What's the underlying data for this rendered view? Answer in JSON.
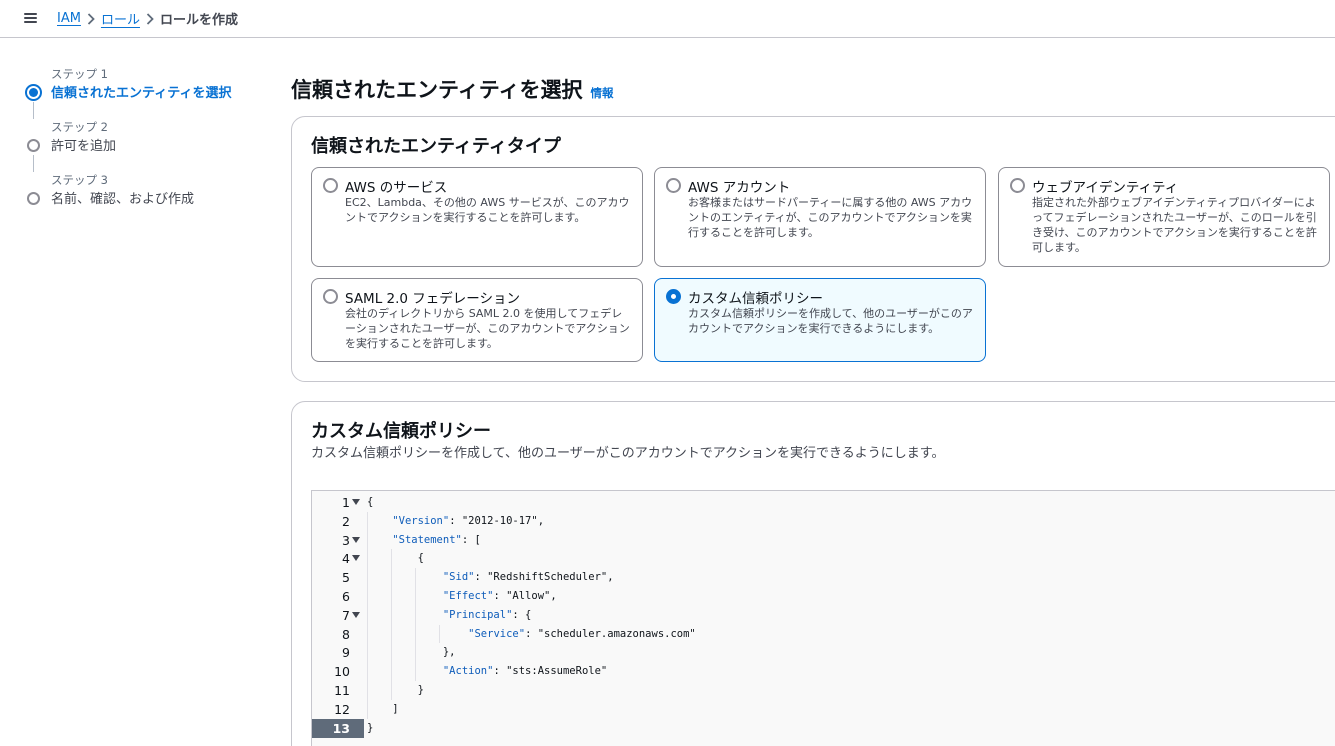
{
  "breadcrumb": {
    "items": [
      "IAM",
      "ロール"
    ],
    "current": "ロールを作成"
  },
  "steps": [
    {
      "num": "ステップ 1",
      "label": "信頼されたエンティティを選択",
      "active": true
    },
    {
      "num": "ステップ 2",
      "label": "許可を追加",
      "active": false
    },
    {
      "num": "ステップ 3",
      "label": "名前、確認、および作成",
      "active": false
    }
  ],
  "page": {
    "title": "信頼されたエンティティを選択",
    "info": "情報"
  },
  "entity_type": {
    "title": "信頼されたエンティティタイプ",
    "options": [
      {
        "title": "AWS のサービス",
        "desc": "EC2、Lambda、その他の AWS サービスが、このアカウントでアクションを実行することを許可します。",
        "selected": false
      },
      {
        "title": "AWS アカウント",
        "desc": "お客様またはサードパーティーに属する他の AWS アカウントのエンティティが、このアカウントでアクションを実行することを許可します。",
        "selected": false
      },
      {
        "title": "ウェブアイデンティティ",
        "desc": "指定された外部ウェブアイデンティティプロバイダーによってフェデレーションされたユーザーが、このロールを引き受け、このアカウントでアクションを実行することを許可します。",
        "selected": false
      },
      {
        "title": "SAML 2.0 フェデレーション",
        "desc": "会社のディレクトリから SAML 2.0 を使用してフェデレーションされたユーザーが、このアカウントでアクションを実行することを許可します。",
        "selected": false
      },
      {
        "title": "カスタム信頼ポリシー",
        "desc": "カスタム信頼ポリシーを作成して、他のユーザーがこのアカウントでアクションを実行できるようにします。",
        "selected": true
      }
    ]
  },
  "custom_policy": {
    "title": "カスタム信頼ポリシー",
    "desc": "カスタム信頼ポリシーを作成して、他のユーザーがこのアカウントでアクションを実行できるようにします。",
    "line_numbers": [
      "1",
      "2",
      "3",
      "4",
      "5",
      "6",
      "7",
      "8",
      "9",
      "10",
      "11",
      "12",
      "13"
    ],
    "lines": [
      "{",
      "    \"Version\": \"2012-10-17\",",
      "    \"Statement\": [",
      "        {",
      "            \"Sid\": \"RedshiftScheduler\",",
      "            \"Effect\": \"Allow\",",
      "            \"Principal\": {",
      "                \"Service\": \"scheduler.amazonaws.com\"",
      "            },",
      "            \"Action\": \"sts:AssumeRole\"",
      "        }",
      "    ]",
      "}"
    ],
    "foldable_lines": [
      1,
      3,
      4,
      7
    ],
    "current_line": 13
  },
  "colors": {
    "accent": "#0972d3",
    "selected_bg": "#f0fbff",
    "border": "#c6c6cd"
  }
}
